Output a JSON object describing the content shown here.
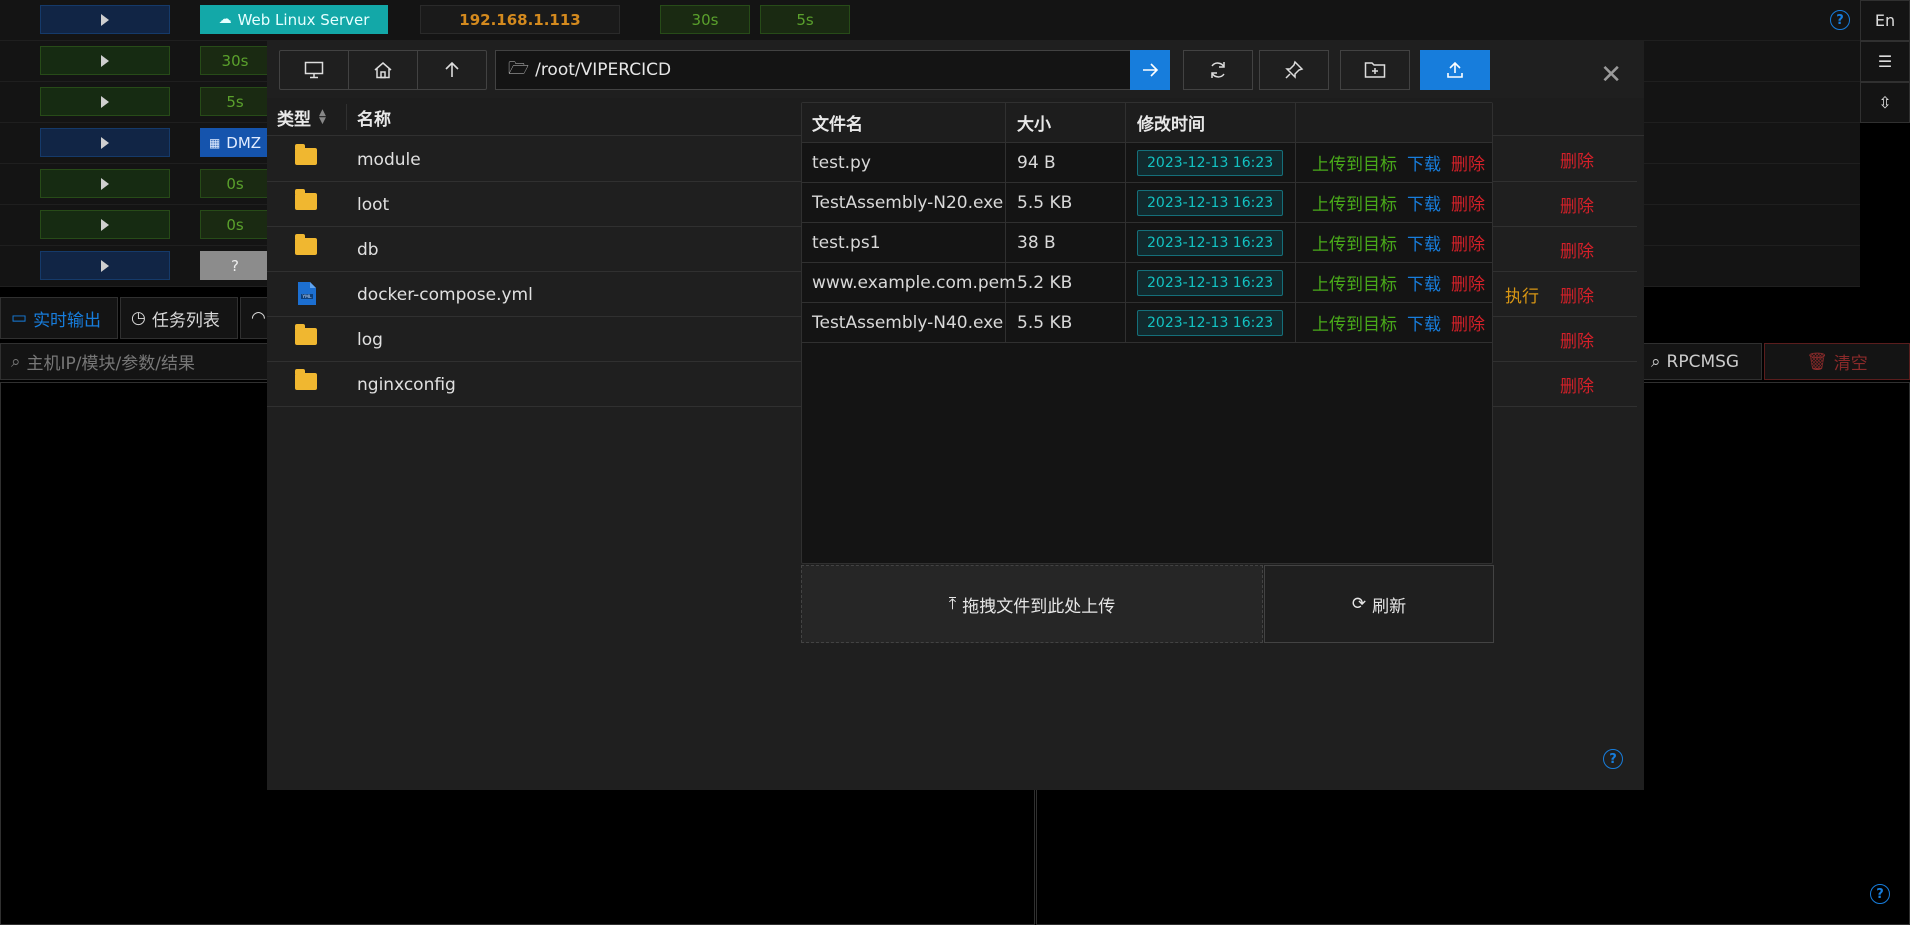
{
  "host_rows": [
    {
      "play_color": "blue",
      "tag": "Web Linux Server",
      "tag_style": "teal",
      "ip": "192.168.1.113",
      "t1": "30s",
      "t2": "5s"
    },
    {
      "play_color": "green",
      "tag": "30s",
      "tag_style": "green"
    },
    {
      "play_color": "green",
      "tag": "5s",
      "tag_style": "green"
    },
    {
      "play_color": "blue",
      "tag": "DMZ",
      "tag_style": "blue"
    },
    {
      "play_color": "green",
      "tag": "0s",
      "tag_style": "green"
    },
    {
      "play_color": "green",
      "tag": "0s",
      "tag_style": "green"
    },
    {
      "play_color": "blue",
      "tag": "?",
      "tag_style": "gray"
    }
  ],
  "side": {
    "lang": "En"
  },
  "bottom": {
    "tab_realtime": "实时输出",
    "tab_tasks": "任务列表",
    "search_placeholder": "主机IP/模块/参数/结果",
    "rpc_search": "RPCMSG",
    "clear_label": "清空"
  },
  "modal": {
    "path": "/root/VIPERCICD",
    "col_type": "类型",
    "col_name": "名称",
    "rows": [
      {
        "icon": "folder-icon",
        "name": "module",
        "action": "",
        "delete": "删除"
      },
      {
        "icon": "folder-icon",
        "name": "loot",
        "action": "",
        "delete": "删除"
      },
      {
        "icon": "folder-icon",
        "name": "db",
        "action": "",
        "delete": "删除"
      },
      {
        "icon": "file-icon",
        "name": "docker-compose.yml",
        "action": "执行",
        "delete": "删除"
      },
      {
        "icon": "folder-icon",
        "name": "log",
        "action": "",
        "delete": "删除"
      },
      {
        "icon": "folder-icon",
        "name": "nginxconfig",
        "action": "",
        "delete": "删除"
      }
    ]
  },
  "files": {
    "headers": {
      "name": "文件名",
      "size": "大小",
      "mtime": "修改时间"
    },
    "rows": [
      {
        "name": "test.py",
        "size": "94 B",
        "mtime": "2023-12-13 16:23",
        "upload": "上传到目标",
        "download": "下载",
        "delete": "删除"
      },
      {
        "name": "TestAssembly-N20.exe",
        "size": "5.5 KB",
        "mtime": "2023-12-13 16:23",
        "upload": "上传到目标",
        "download": "下载",
        "delete": "删除"
      },
      {
        "name": "test.ps1",
        "size": "38 B",
        "mtime": "2023-12-13 16:23",
        "upload": "上传到目标",
        "download": "下载",
        "delete": "删除"
      },
      {
        "name": "www.example.com.pem",
        "size": "5.2 KB",
        "mtime": "2023-12-13 16:23",
        "upload": "上传到目标",
        "download": "下载",
        "delete": "删除"
      },
      {
        "name": "TestAssembly-N40.exe",
        "size": "5.5 KB",
        "mtime": "2023-12-13 16:23",
        "upload": "上传到目标",
        "download": "下载",
        "delete": "删除"
      }
    ],
    "drop_label": "拖拽文件到此处上传",
    "refresh_label": "刷新"
  },
  "colors": {
    "accent": "#177ddc",
    "danger": "#d32029",
    "success": "#49aa19",
    "warning": "#d89614",
    "cyan": "#13c2c2"
  }
}
